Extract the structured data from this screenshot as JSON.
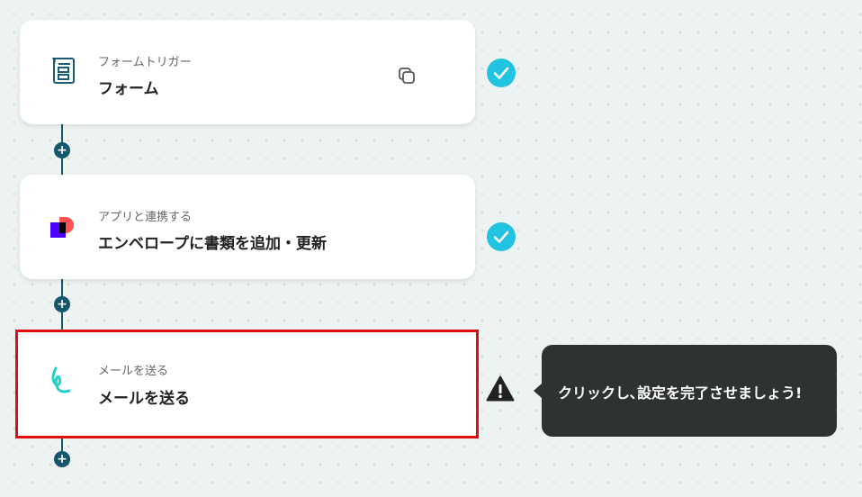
{
  "colors": {
    "connector": "#14566a",
    "check": "#22c3e0",
    "selected_border": "#e00d0d",
    "tooltip_bg": "#2f3233"
  },
  "flow": {
    "steps": [
      {
        "subtitle": "フォームトリガー",
        "title": "フォーム",
        "icon": "form-icon",
        "status_icon": "check-icon",
        "has_copy_button": true
      },
      {
        "subtitle": "アプリと連携する",
        "title": "エンベロープに書類を追加・更新",
        "icon": "docusign-app-icon",
        "status_icon": "check-icon"
      },
      {
        "subtitle": "メールを送る",
        "title": "メールを送る",
        "icon": "yoom-mail-icon",
        "status_icon": "warning-icon",
        "selected": true
      }
    ],
    "add_step_icon": "plus-icon",
    "copy_icon": "copy-icon"
  },
  "tooltip": {
    "text": "クリックし､設定を完了させましょう!"
  }
}
